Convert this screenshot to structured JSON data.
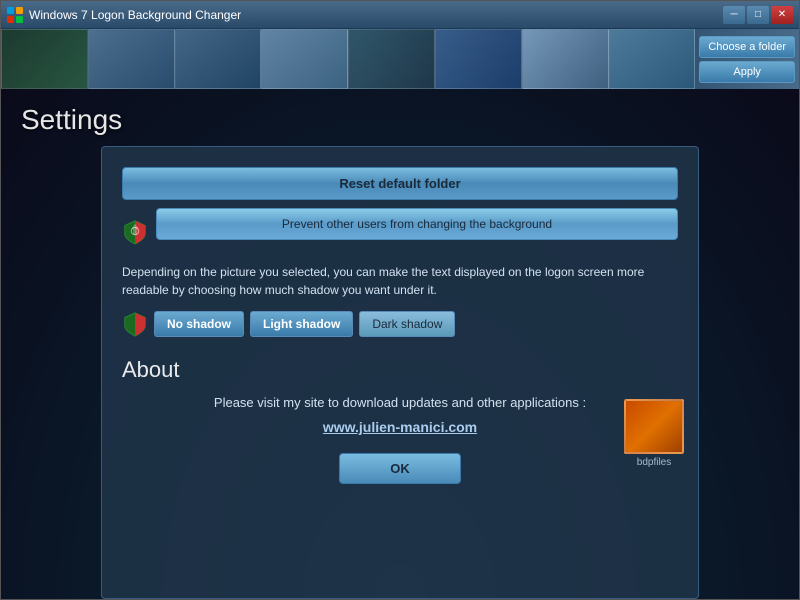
{
  "window": {
    "title": "Windows 7 Logon Background Changer",
    "titlebar_buttons": {
      "minimize": "─",
      "maximize": "□",
      "close": "✕"
    }
  },
  "sidebar": {
    "choose_folder": "Choose a folder",
    "apply": "Apply",
    "settings": "Settings"
  },
  "settings": {
    "title": "Settings",
    "reset_btn": "Reset default folder",
    "prevent_btn": "Prevent other users from changing the background",
    "description": "Depending on the picture you selected, you can make the text displayed on the logon screen more readable by choosing how much shadow you want under it.",
    "shadow_buttons": [
      {
        "label": "No shadow",
        "state": "active"
      },
      {
        "label": "Light shadow",
        "state": "active"
      },
      {
        "label": "Dark shadow",
        "state": "inactive"
      }
    ]
  },
  "about": {
    "title": "About",
    "text": "Please visit my site to download updates and other applications :",
    "link": "www.julien-manici.com"
  },
  "ok_button": "OK",
  "preview_label": "bdpfiles",
  "watermark": "bdpfiles"
}
